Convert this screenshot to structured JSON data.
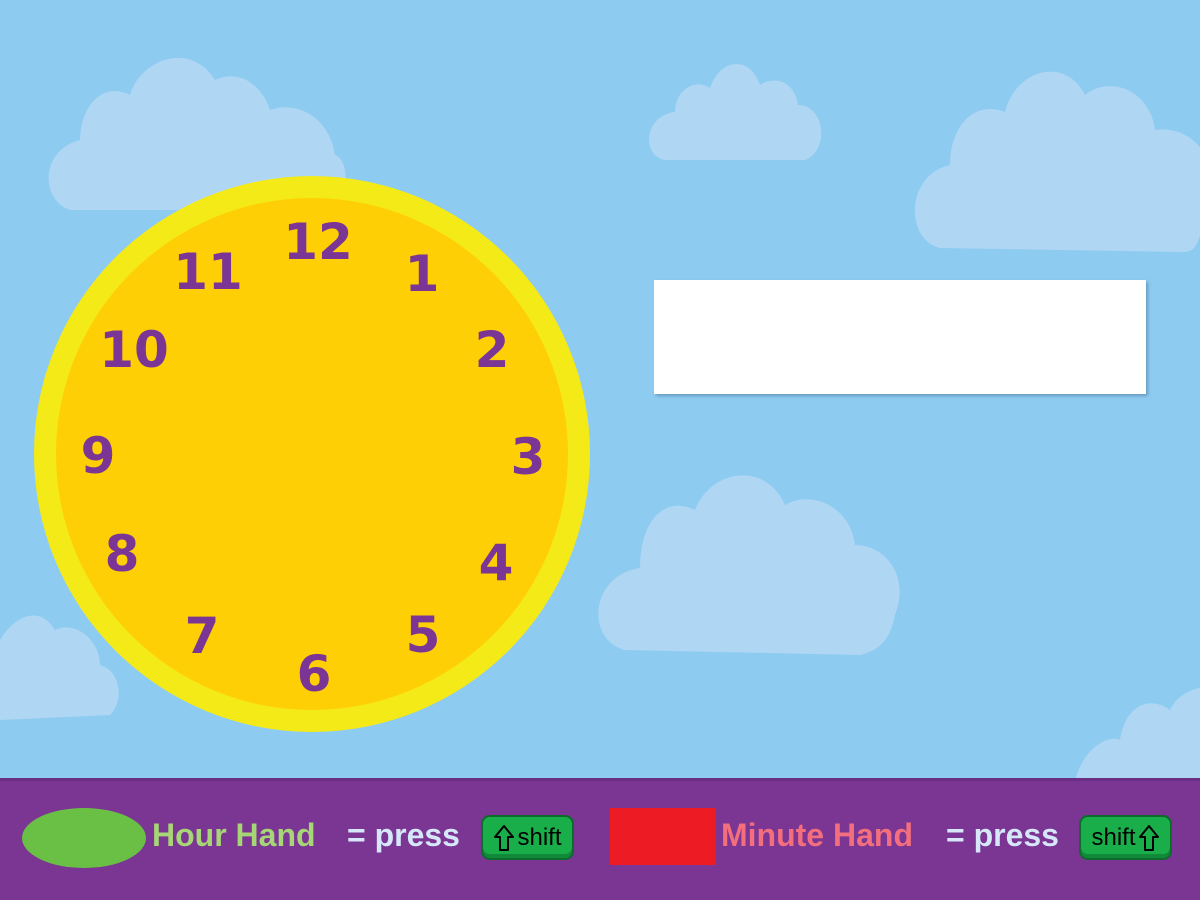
{
  "clock": {
    "numbers": [
      "12",
      "1",
      "2",
      "3",
      "4",
      "5",
      "6",
      "7",
      "8",
      "9",
      "10",
      "11"
    ]
  },
  "answer_box": {
    "value": ""
  },
  "legend": {
    "hour": {
      "label": "Hour Hand",
      "equals_press": "= press",
      "key_label": "shift",
      "swatch_color": "#6abf45"
    },
    "minute": {
      "label": "Minute Hand",
      "equals_press": "= press",
      "key_label": "shift",
      "swatch_color": "#ed1c24"
    }
  },
  "colors": {
    "sky": "#8ecbf0",
    "cloud": "#afd6f3",
    "clock_rim": "#f4ea17",
    "clock_face": "#ffcf05",
    "numbers": "#7a3595",
    "bar": "#7b3593",
    "key": "#1aae4a"
  }
}
